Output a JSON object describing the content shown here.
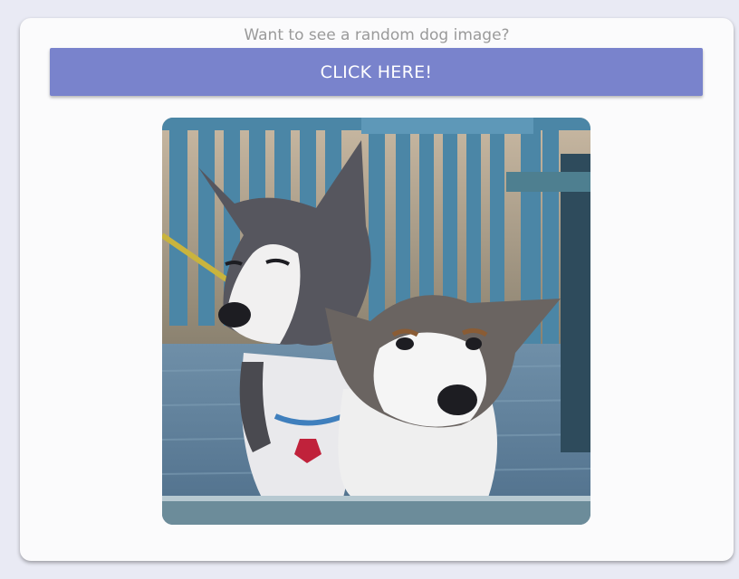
{
  "header": {
    "prompt_text": "Want to see a random dog image?"
  },
  "action": {
    "button_label": "CLICK HERE!"
  },
  "image": {
    "subject": "dog-photo"
  },
  "colors": {
    "page_background": "#e9eaf4",
    "card_background": "#fbfbfc",
    "button_background": "#7983cc",
    "prompt_text": "#9a9a9a"
  }
}
